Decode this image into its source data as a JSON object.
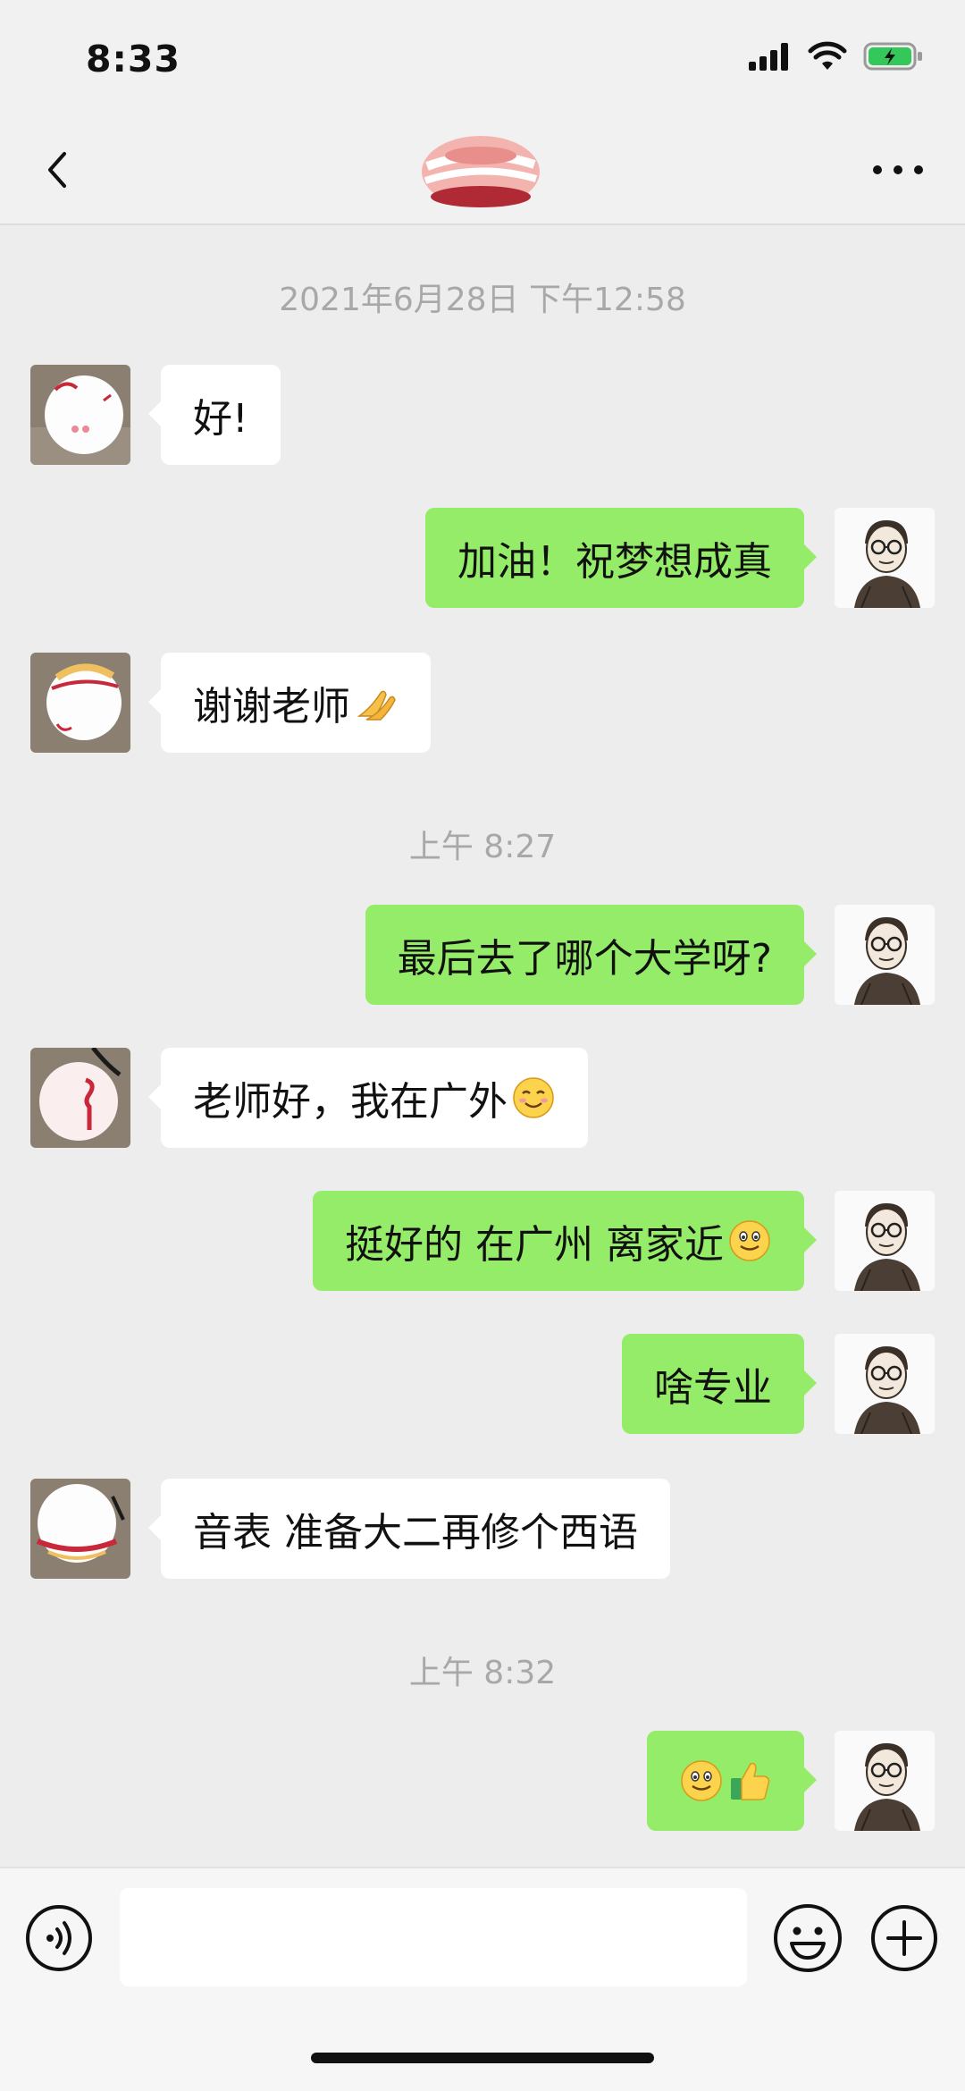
{
  "status_bar": {
    "time": "8:33"
  },
  "nav": {
    "back_icon": "chevron-left-icon",
    "more_icon": "more-dots-icon"
  },
  "colors": {
    "sent_bubble": "#95ec69",
    "received_bubble": "#ffffff",
    "background": "#ededed",
    "timestamp": "#a8a8a8"
  },
  "chat": {
    "timestamps": [
      "2021年6月28日 下午12:58",
      "上午 8:27",
      "上午 8:32"
    ],
    "messages": [
      {
        "side": "left",
        "text": "好!"
      },
      {
        "side": "right",
        "text": "加油！祝梦想成真"
      },
      {
        "side": "left",
        "text": "谢谢老师",
        "emoji": "folded-hands-emoji"
      },
      {
        "side": "right",
        "text": "最后去了哪个大学呀?"
      },
      {
        "side": "left",
        "text": "老师好，我在广外",
        "emoji": "smiling-face-emoji"
      },
      {
        "side": "right",
        "text": "挺好的 在广州 离家近",
        "emoji": "smiley-emoji"
      },
      {
        "side": "right",
        "text": "啥专业"
      },
      {
        "side": "left",
        "text": "音表 准备大二再修个西语"
      },
      {
        "side": "right",
        "text": "",
        "emoji": "smiley-and-thumbs-up-emoji"
      }
    ]
  },
  "input_bar": {
    "voice_icon": "voice-icon",
    "emoji_icon": "emoji-face-icon",
    "plus_icon": "plus-circle-icon",
    "input_value": ""
  }
}
